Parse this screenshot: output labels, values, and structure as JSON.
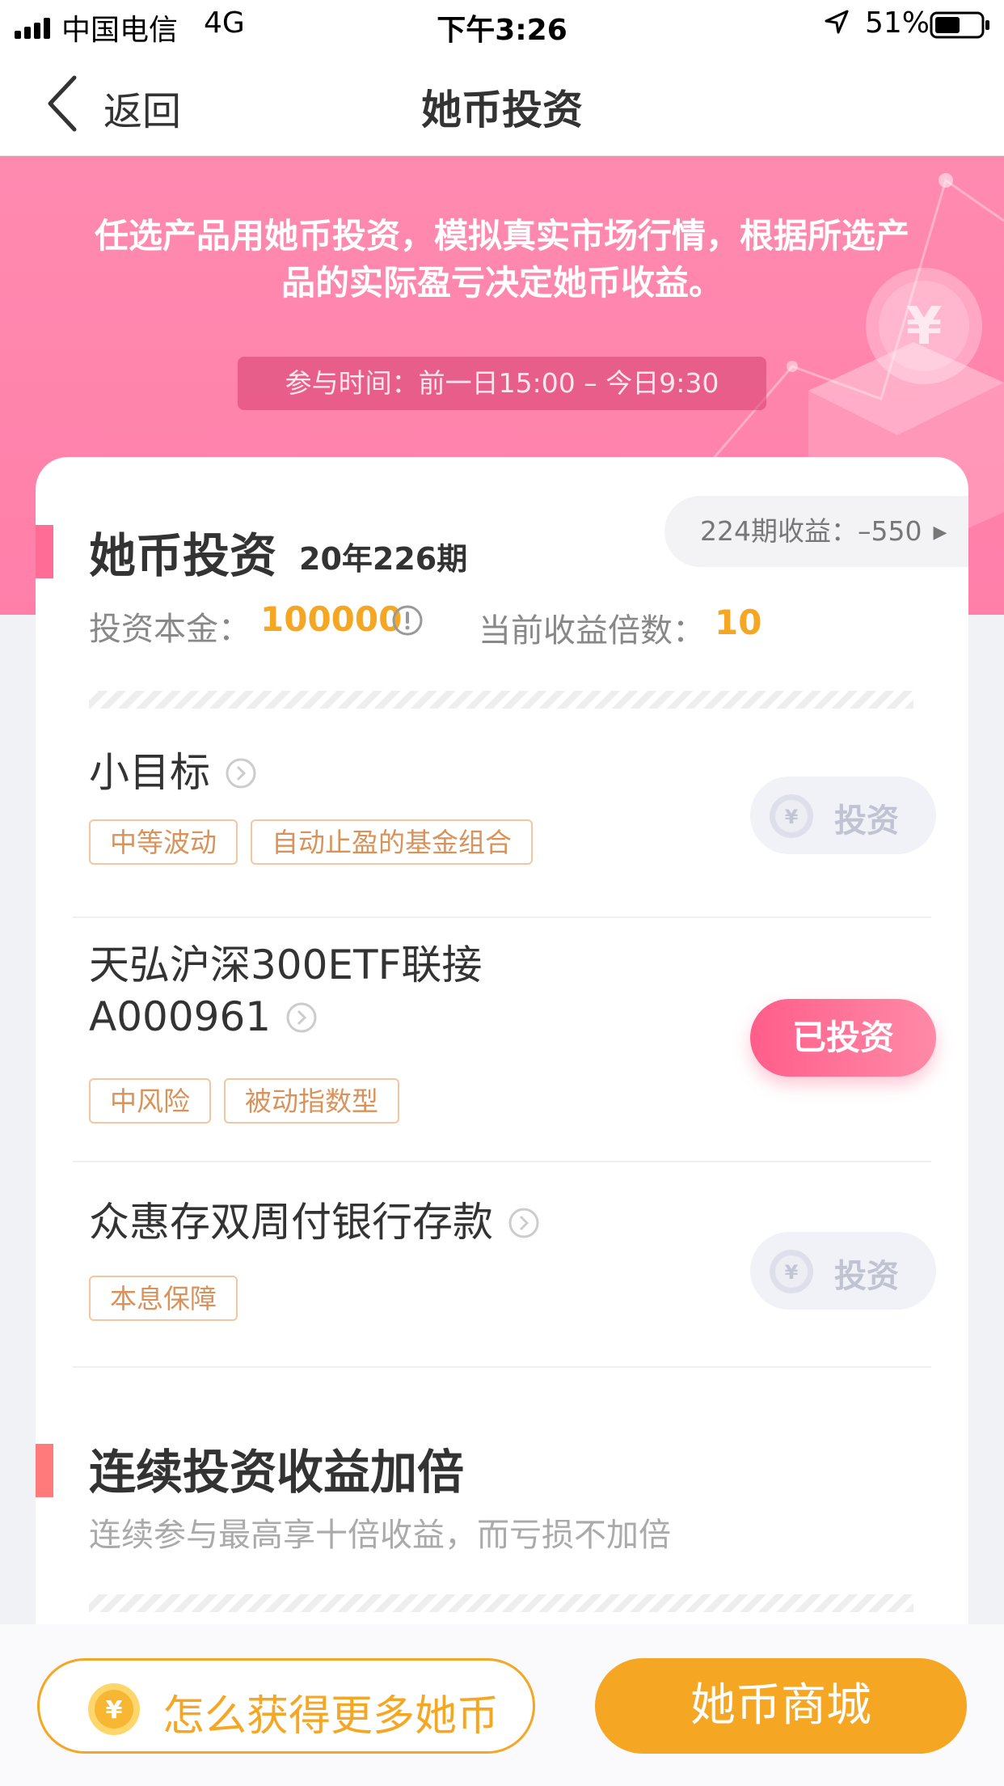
{
  "status_bar": {
    "carrier": "中国电信",
    "network": "4G",
    "time": "下午3:26",
    "battery_pct": "51%"
  },
  "nav": {
    "back_label": "返回",
    "title": "她币投资"
  },
  "banner": {
    "description": "任选产品用她币投资，模拟真实市场行情，根据所选产品的实际盈亏决定她币收益。",
    "time_range": "参与时间：前一日15:00 – 今日9:30"
  },
  "investment": {
    "title": "她币投资",
    "period": "20年226期",
    "prev_return": "224期收益：–550",
    "principal_label": "投资本金：",
    "principal_value": "100000",
    "multiplier_label": "当前收益倍数：",
    "multiplier_value": "10"
  },
  "products": [
    {
      "name": "小目标",
      "tags": [
        "中等波动",
        "自动止盈的基金组合"
      ],
      "action": "投资"
    },
    {
      "name_line1": "天弘沪深300ETF联接",
      "name_line2": "A000961",
      "tags": [
        "中风险",
        "被动指数型"
      ],
      "action": "已投资"
    },
    {
      "name": "众惠存双周付银行存款",
      "tags": [
        "本息保障"
      ],
      "action": "投资"
    }
  ],
  "continuous": {
    "title": "连续投资收益加倍",
    "subtitle": "连续参与最高享十倍收益，而亏损不加倍"
  },
  "bottom": {
    "more_coins": "怎么获得更多她币",
    "mall": "她币商城"
  },
  "colors": {
    "banner_pink": "#ff84ad",
    "accent_orange": "#f5a623",
    "invested_pink": "#ff6d96",
    "tag_border": "#f2c7a0"
  }
}
